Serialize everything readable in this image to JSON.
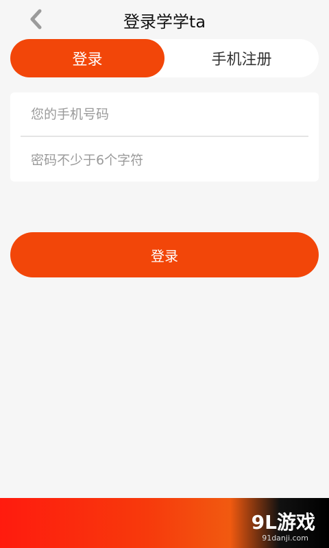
{
  "header": {
    "title": "登录学学ta"
  },
  "tabs": {
    "active": "登录",
    "inactive": "手机注册"
  },
  "form": {
    "phone_placeholder": "您的手机号码",
    "password_placeholder": "密码不少于6个字符"
  },
  "actions": {
    "login_label": "登录"
  },
  "banner": {
    "brand": "9L游戏",
    "url": "91danji.com"
  },
  "colors": {
    "accent": "#f24609"
  }
}
